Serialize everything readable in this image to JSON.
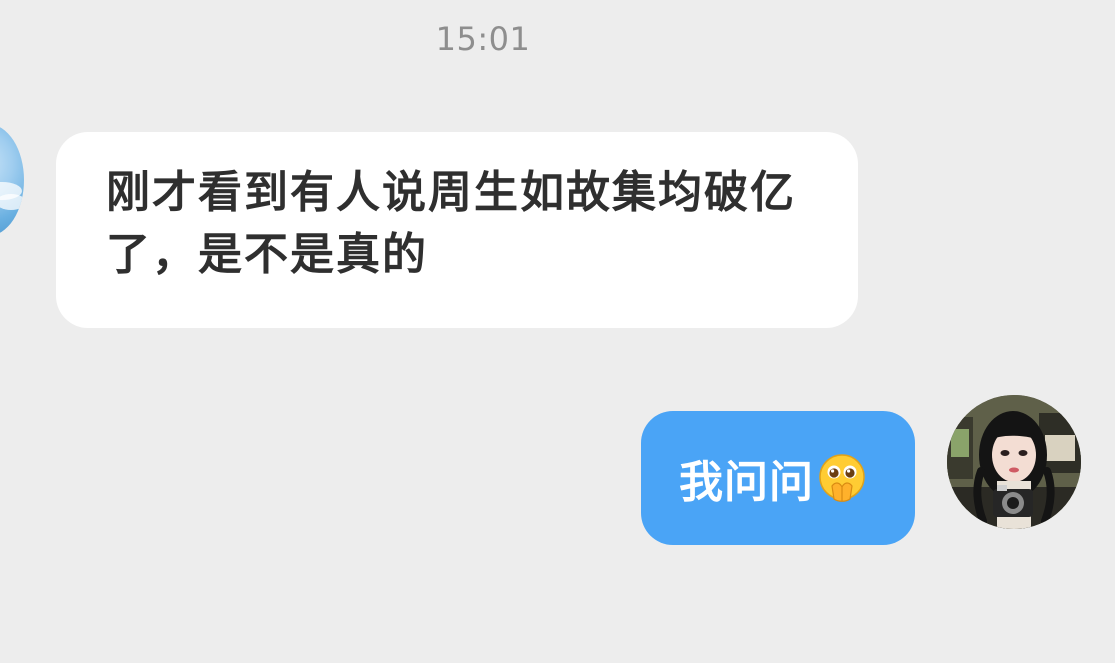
{
  "chat": {
    "timestamp": "15:01",
    "messages": [
      {
        "side": "left",
        "text": "刚才看到有人说周生如故集均破亿了，是不是真的",
        "bubble_color": "#ffffff",
        "text_color": "#2f2f2f"
      },
      {
        "side": "right",
        "text": "我问问",
        "emoji": "pleading-hands-emoji",
        "bubble_color": "#4aa4f6",
        "text_color": "#ffffff"
      }
    ],
    "colors": {
      "background": "#ededed",
      "timestamp": "#8e8e8e"
    }
  }
}
